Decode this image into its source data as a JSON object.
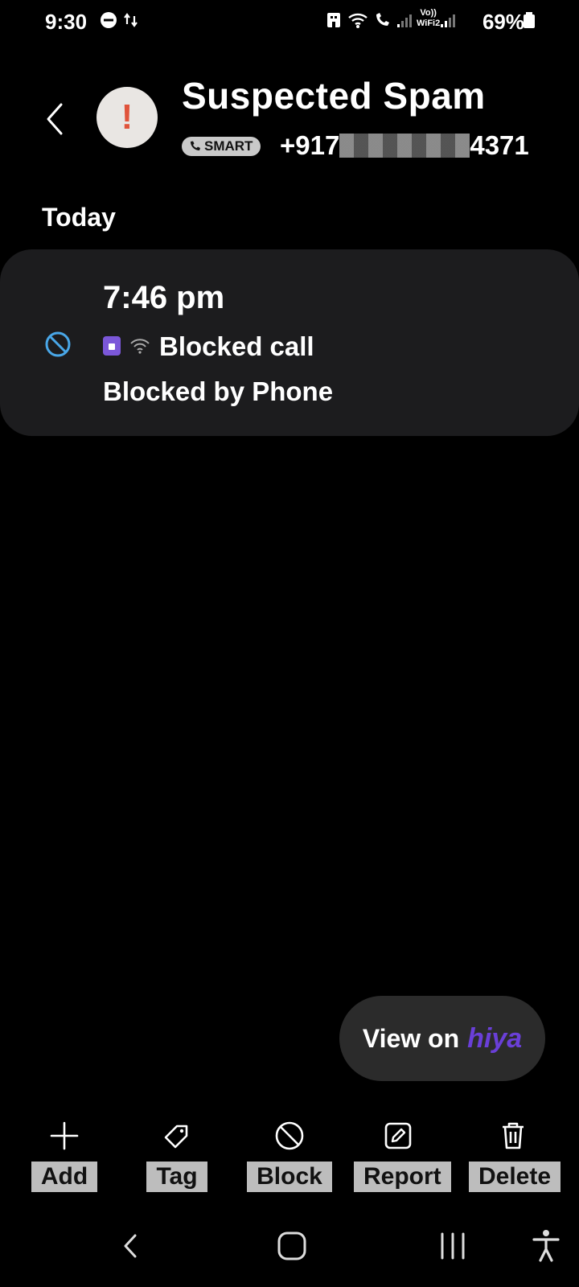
{
  "status_bar": {
    "time": "9:30",
    "battery": "69%",
    "network_label_top": "Vo))",
    "network_label_bottom": "WiFi2"
  },
  "header": {
    "title": "Suspected Spam",
    "badge": "SMART",
    "number_prefix": "+917",
    "number_suffix": "4371",
    "avatar_icon": "exclamation-icon"
  },
  "section_title": "Today",
  "call": {
    "time": "7:46 pm",
    "type": "Blocked call",
    "note": "Blocked by Phone",
    "icon_color": "#49a7e8"
  },
  "hiya": {
    "label": "View on",
    "brand": "hiya"
  },
  "actions": [
    {
      "label": "Add",
      "icon": "plus-icon"
    },
    {
      "label": "Tag",
      "icon": "tag-icon"
    },
    {
      "label": "Block",
      "icon": "block-icon"
    },
    {
      "label": "Report",
      "icon": "report-icon"
    },
    {
      "label": "Delete",
      "icon": "trash-icon"
    }
  ]
}
